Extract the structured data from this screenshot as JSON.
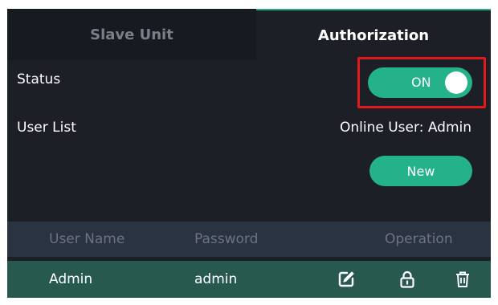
{
  "tabs": {
    "slave_unit": "Slave Unit",
    "authorization": "Authorization",
    "active": "Authorization"
  },
  "status": {
    "label": "Status",
    "toggle_text": "ON",
    "toggle_on": true
  },
  "user_list": {
    "label": "User List",
    "online_user": "Online User: Admin",
    "new_button": "New"
  },
  "table": {
    "columns": [
      "User Name",
      "Password",
      "Operation"
    ],
    "rows": [
      {
        "user_name": "Admin",
        "password": "admin",
        "operations": [
          "edit-icon",
          "lock-icon",
          "trash-icon"
        ]
      }
    ]
  },
  "colors": {
    "accent": "#23b28a",
    "background": "#1c1f26",
    "highlight_box": "#e0191b",
    "row_selected": "#27594f",
    "table_header": "#2a3341"
  }
}
